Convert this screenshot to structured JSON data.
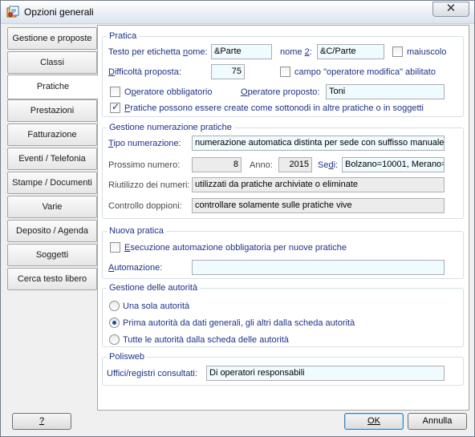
{
  "window": {
    "title": "Opzioni generali",
    "close_symbol": "✕"
  },
  "sidebar": {
    "tabs": [
      {
        "label": "Gestione e proposte"
      },
      {
        "label": "Classi"
      },
      {
        "label": "Pratiche",
        "active": true
      },
      {
        "label": "Prestazioni"
      },
      {
        "label": "Fatturazione"
      },
      {
        "label": "Eventi / Telefonia"
      },
      {
        "label": "Stampe / Documenti"
      },
      {
        "label": "Varie"
      },
      {
        "label": "Deposito / Agenda"
      },
      {
        "label": "Soggetti"
      },
      {
        "label": "Cerca testo libero"
      }
    ]
  },
  "pratica": {
    "legend": "Pratica",
    "testo_label_pre": "Testo per etichetta ",
    "testo_label_u": "n",
    "testo_label_post": "ome:",
    "nome1_value": "&Parte",
    "nome2_label_pre": "nome ",
    "nome2_label_u": "2",
    "nome2_label_post": ":",
    "nome2_value": "&C/Parte",
    "maiuscolo_label": "maiuscolo",
    "difficolta_label_u": "D",
    "difficolta_label_post": "ifficoltà proposta:",
    "difficolta_value": "75",
    "campo_label": "campo \"operatore modifica\" abilitato",
    "operatore_obbl_label_pre": "O",
    "operatore_obbl_label_u": "p",
    "operatore_obbl_label_post": "eratore obbligatorio",
    "operatore_prop_label_pre": "",
    "operatore_prop_label_u": "O",
    "operatore_prop_label_post": "peratore proposto:",
    "operatore_prop_value": "Toni",
    "sottonodi_label_u": "P",
    "sottonodi_label_post": "ratiche possono essere create come sottonodi in altre pratiche o in soggetti"
  },
  "numerazione": {
    "legend": "Gestione numerazione pratiche",
    "tipo_label_u": "T",
    "tipo_label_post": "ipo numerazione:",
    "tipo_value": "numerazione automatica distinta per sede con suffisso manuale",
    "prossimo_label": "Prossimo numero:",
    "prossimo_value": "8",
    "anno_label": "Anno:",
    "anno_value": "2015",
    "sedi_label_pre": "Se",
    "sedi_label_u": "d",
    "sedi_label_post": "i:",
    "sedi_value": "Bolzano=10001, Merano=",
    "riutilizzo_label": "Riutilizzo dei numeri:",
    "riutilizzo_value": "utilizzati da pratiche archiviate o eliminate",
    "doppioni_label": "Controllo doppioni:",
    "doppioni_value": "controllare solamente sulle pratiche vive"
  },
  "nuova": {
    "legend": "Nuova pratica",
    "esecuzione_label_u": "E",
    "esecuzione_label_post": "secuzione automazione obbligatoria per nuove pratiche",
    "automazione_label_u": "A",
    "automazione_label_post": "utomazione:",
    "automazione_value": ""
  },
  "autorita": {
    "legend": "Gestione delle autorità",
    "options": [
      {
        "label": "Una sola autorità",
        "checked": false
      },
      {
        "label": "Prima autorità da dati generali, gli altri dalla scheda autorità",
        "checked": true
      },
      {
        "label": "Tutte le autorità dalla scheda delle autorità",
        "checked": false
      }
    ]
  },
  "polisweb": {
    "legend": "Polisweb",
    "uffici_label": "Uffici/registri consultati:",
    "uffici_value": "Di operatori responsabili"
  },
  "footer": {
    "help_label": "?",
    "ok_label": "OK",
    "cancel_label": "Annulla"
  }
}
